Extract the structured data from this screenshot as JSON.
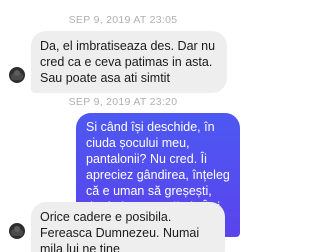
{
  "timestamps": [
    "SEP 9, 2019 AT 23:05",
    "SEP 9, 2019 AT 23:20"
  ],
  "messages": [
    {
      "direction": "incoming",
      "text": "Da, el imbratiseaza des. Dar nu cred ca e ceva patimas in asta. Sau poate asa ati simtit"
    },
    {
      "direction": "outgoing",
      "text": "Si când își deschide, în ciuda șocului meu, pantalonii? Nu cred. Îi apreciez gândirea, înțeleg că e uman să greșești, dar îmi e greu să uit. Îmi pare rău."
    },
    {
      "direction": "incoming",
      "text": "Orice cadere e posibila. Fereasca Dumnezeu. Numai mila lui ne tine"
    }
  ],
  "colors": {
    "incoming_bubble": "#eeeeef",
    "outgoing_bubble": "#5250f0",
    "timestamp": "#b0b0b0"
  }
}
